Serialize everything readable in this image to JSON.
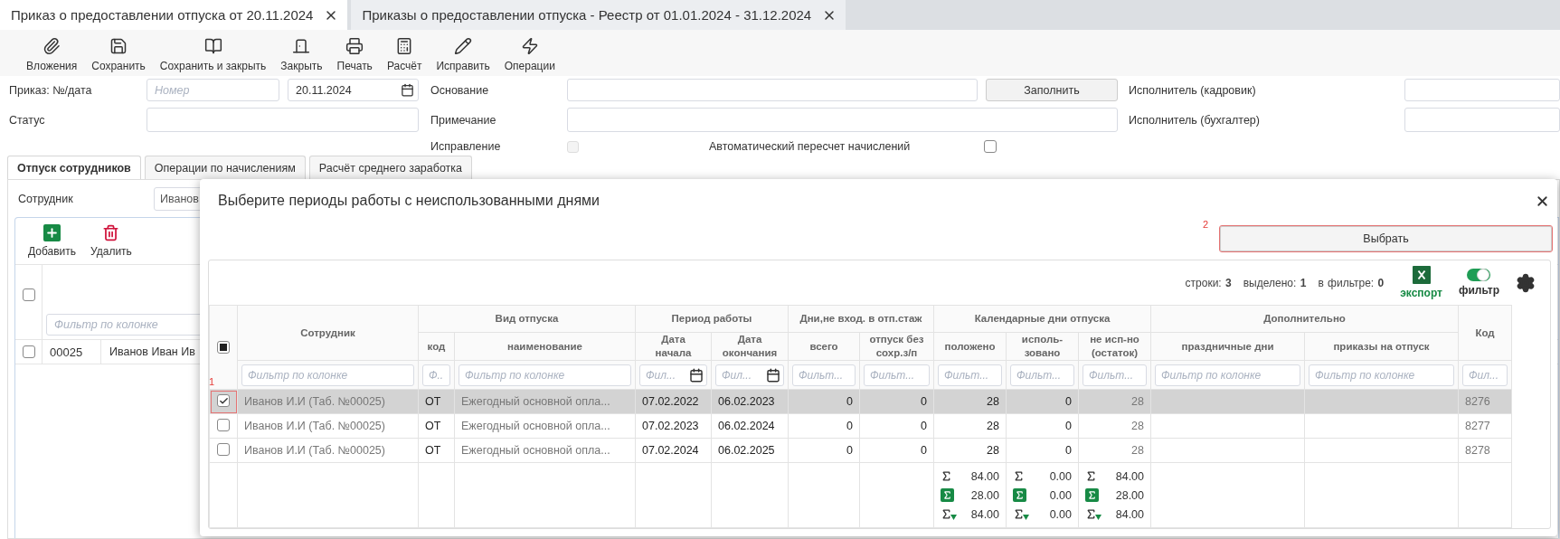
{
  "tabs": [
    {
      "label": "Приказ о предоставлении отпуска от 20.11.2024",
      "selected": true
    },
    {
      "label": "Приказы о предоставлении отпуска - Реестр от 01.01.2024 - 31.12.2024",
      "selected": false
    }
  ],
  "toolbar": [
    "Вложения",
    "Сохранить",
    "Сохранить и закрыть",
    "Закрыть",
    "Печать",
    "Расчёт",
    "Исправить",
    "Операции"
  ],
  "form": {
    "order_label": "Приказ: №/дата",
    "number_placeholder": "Номер",
    "date_value": "20.11.2024",
    "basis_label": "Основание",
    "fill_button": "Заполнить",
    "hr_label": "Исполнитель (кадровик)",
    "status_label": "Статус",
    "note_label": "Примечание",
    "accountant_label": "Исполнитель (бухгалтер)",
    "correction_label": "Исправление",
    "correction": {
      "checked": false,
      "disabled": true
    },
    "auto_recalc_label": "Автоматический пересчет начислений",
    "auto_recalc": {
      "checked": false
    }
  },
  "section_tabs": [
    {
      "label": "Отпуск сотрудников",
      "selected": true
    },
    {
      "label": "Операции по начислениям",
      "selected": false
    },
    {
      "label": "Расчёт среднего заработка",
      "selected": false
    }
  ],
  "employee": {
    "label": "Сотрудник",
    "value": "Иванов"
  },
  "employee_grid": {
    "actions": [
      "Добавить",
      "Удалить"
    ],
    "header_checked": false,
    "filter_placeholder": "Фильтр по колонке",
    "rows": [
      {
        "checked": false,
        "cells": [
          "00025",
          "Иванов Иван Ив"
        ]
      }
    ]
  },
  "dialog": {
    "title": "Выберите периоды работы с неиспользованными днями",
    "select_button": "Выбрать",
    "select_button_annotation": "2",
    "stats": [
      {
        "label": "строки:",
        "value": "3"
      },
      {
        "label": "выделено:",
        "value": "1"
      },
      {
        "label": "в фильтре:",
        "value": "0"
      }
    ],
    "export_label": "экспорт",
    "filter_label": "фильтр",
    "filter_on": true,
    "header_partial": true,
    "column_groups": [
      {
        "columns": [
          {
            "label": "Сотрудник",
            "placeholder": "Фильтр по колонке",
            "kind": "text",
            "muted": true
          }
        ]
      },
      {
        "label": "Вид отпуска",
        "columns": [
          {
            "label": "код",
            "placeholder": "Ф..",
            "kind": "text",
            "muted": false
          },
          {
            "label": "наименование",
            "placeholder": "Фильтр по колонке",
            "kind": "text",
            "muted": true
          }
        ]
      },
      {
        "label": "Период работы",
        "columns": [
          {
            "label": "Дата\nначала",
            "placeholder": "Фил...",
            "kind": "date",
            "muted": false
          },
          {
            "label": "Дата\nокончания",
            "placeholder": "Фил...",
            "kind": "date",
            "muted": false
          }
        ]
      },
      {
        "label": "Дни,не вход. в отп.стаж",
        "columns": [
          {
            "label": "всего",
            "placeholder": "Фильт...",
            "kind": "number",
            "muted": false
          },
          {
            "label": "отпуск без\nсохр.з/п",
            "placeholder": "Фильт...",
            "kind": "number",
            "muted": false
          }
        ]
      },
      {
        "label": "Календарные дни отпуска",
        "columns": [
          {
            "label": "положено",
            "placeholder": "Фильт...",
            "kind": "number",
            "muted": false,
            "totals": [
              {
                "kind": "sum",
                "value": "84.00"
              },
              {
                "kind": "selected_sum",
                "value": "28.00"
              },
              {
                "kind": "filtered_sum",
                "value": "84.00"
              }
            ]
          },
          {
            "label": "исполь-\nзовано",
            "placeholder": "Фильт...",
            "kind": "number",
            "muted": false,
            "totals": [
              {
                "kind": "sum",
                "value": "0.00"
              },
              {
                "kind": "selected_sum",
                "value": "0.00"
              },
              {
                "kind": "filtered_sum",
                "value": "0.00"
              }
            ]
          },
          {
            "label": "не исп-но\n(остаток)",
            "placeholder": "Фильт...",
            "kind": "number",
            "muted": true,
            "totals": [
              {
                "kind": "sum",
                "value": "84.00"
              },
              {
                "kind": "selected_sum",
                "value": "28.00"
              },
              {
                "kind": "filtered_sum",
                "value": "84.00"
              }
            ]
          }
        ]
      },
      {
        "label": "Дополнительно",
        "columns": [
          {
            "label": "праздничные дни",
            "placeholder": "Фильтр по колонке",
            "kind": "text"
          },
          {
            "label": "приказы на отпуск",
            "placeholder": "Фильтр по колонке",
            "kind": "text"
          }
        ]
      },
      {
        "columns": [
          {
            "label": "Код",
            "placeholder": "Фил...",
            "kind": "text",
            "muted": true
          }
        ]
      }
    ],
    "rows": [
      {
        "selected": true,
        "checked": true,
        "annotation": "1",
        "cells": [
          "Иванов И.И (Таб. №00025)",
          "ОТ",
          "Ежегодный основной опла...",
          "07.02.2022",
          "06.02.2023",
          "0",
          "0",
          "28",
          "0",
          "28",
          null,
          null,
          "8276"
        ]
      },
      {
        "selected": false,
        "checked": false,
        "cells": [
          "Иванов И.И (Таб. №00025)",
          "ОТ",
          "Ежегодный основной опла...",
          "07.02.2023",
          "06.02.2024",
          "0",
          "0",
          "28",
          "0",
          "28",
          null,
          null,
          "8277"
        ]
      },
      {
        "selected": false,
        "checked": false,
        "cells": [
          "Иванов И.И (Таб. №00025)",
          "ОТ",
          "Ежегодный основной опла...",
          "07.02.2024",
          "06.02.2025",
          "0",
          "0",
          "28",
          "0",
          "28",
          null,
          null,
          "8278"
        ]
      }
    ]
  }
}
